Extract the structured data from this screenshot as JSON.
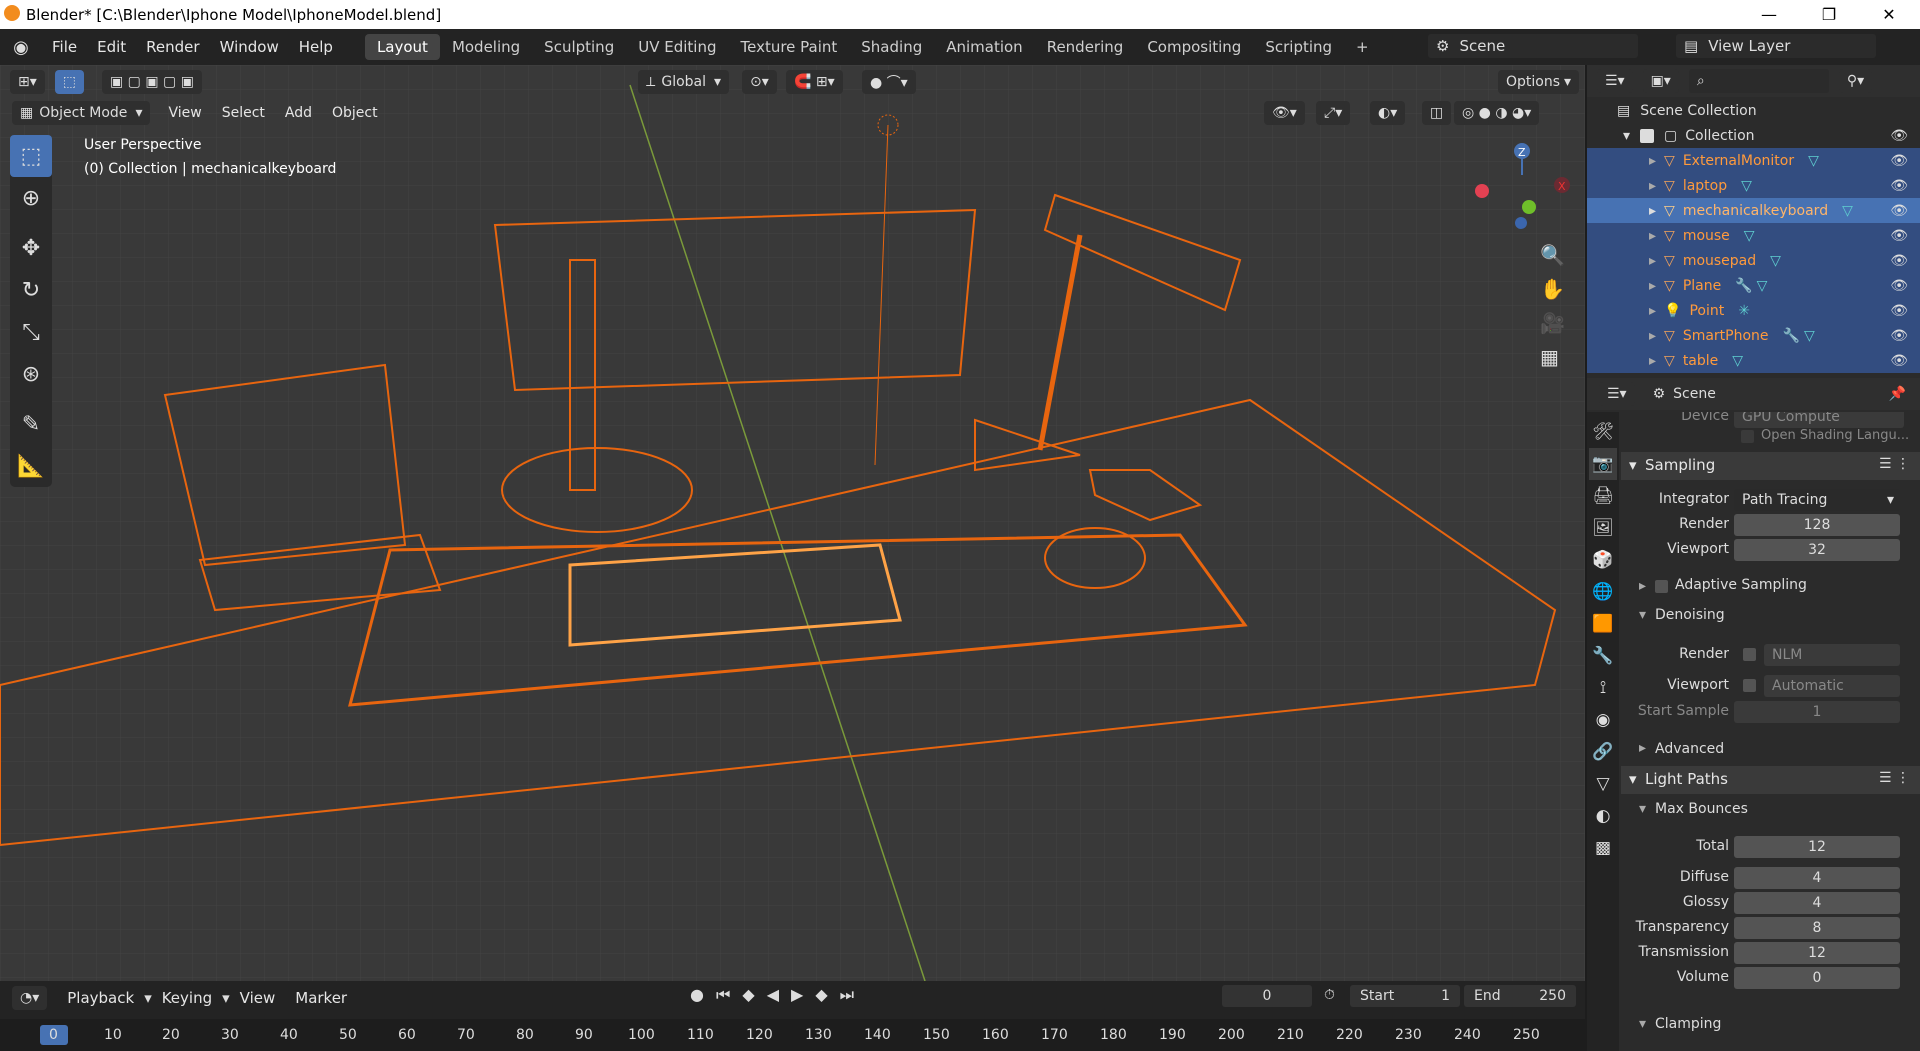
{
  "window": {
    "title": "Blender* [C:\\Blender\\Iphone Model\\IphoneModel.blend]",
    "min": "—",
    "max": "❐",
    "close": "✕"
  },
  "menus": [
    "File",
    "Edit",
    "Render",
    "Window",
    "Help"
  ],
  "workspaces": [
    "Layout",
    "Modeling",
    "Sculpting",
    "UV Editing",
    "Texture Paint",
    "Shading",
    "Animation",
    "Rendering",
    "Compositing",
    "Scripting",
    "+"
  ],
  "scene": {
    "name": "Scene",
    "view_layer": "View Layer"
  },
  "viewport": {
    "mode": "Object Mode",
    "menus": [
      "View",
      "Select",
      "Add",
      "Object"
    ],
    "orientation": "Global",
    "options": "Options",
    "perspective": "User Perspective",
    "collection_info": "(0) Collection | mechanicalkeyboard",
    "gizmo": {
      "z": "Z",
      "x": "X"
    }
  },
  "outliner": {
    "root": "Scene Collection",
    "collection": "Collection",
    "items": [
      {
        "name": "ExternalMonitor",
        "selected": true
      },
      {
        "name": "laptop",
        "selected": true
      },
      {
        "name": "mechanicalkeyboard",
        "selected": true,
        "active": true
      },
      {
        "name": "mouse",
        "selected": true
      },
      {
        "name": "mousepad",
        "selected": true
      },
      {
        "name": "Plane",
        "selected": true
      },
      {
        "name": "Point",
        "selected": true
      },
      {
        "name": "SmartPhone",
        "selected": true
      },
      {
        "name": "table",
        "selected": true
      }
    ]
  },
  "properties": {
    "context": "Scene",
    "device_label": "Device",
    "device_value": "GPU Compute",
    "open_shading": "Open Shading Langu...",
    "sampling": {
      "title": "Sampling",
      "integrator_label": "Integrator",
      "integrator": "Path Tracing",
      "render_label": "Render",
      "render": "128",
      "viewport_label": "Viewport",
      "viewport": "32",
      "adaptive": "Adaptive Sampling",
      "denoising": "Denoising",
      "den_render_label": "Render",
      "den_render": "NLM",
      "den_viewport_label": "Viewport",
      "den_viewport": "Automatic",
      "start_sample_label": "Start Sample",
      "start_sample": "1",
      "advanced": "Advanced"
    },
    "light_paths": {
      "title": "Light Paths",
      "max_bounces": "Max Bounces",
      "rows": [
        {
          "label": "Total",
          "value": "12"
        },
        {
          "label": "Diffuse",
          "value": "4"
        },
        {
          "label": "Glossy",
          "value": "4"
        },
        {
          "label": "Transparency",
          "value": "8"
        },
        {
          "label": "Transmission",
          "value": "12"
        },
        {
          "label": "Volume",
          "value": "0"
        }
      ],
      "clamping": "Clamping"
    }
  },
  "timeline": {
    "menus": [
      "Playback",
      "Keying",
      "View",
      "Marker"
    ],
    "current_frame": "0",
    "start_label": "Start",
    "start": "1",
    "end_label": "End",
    "end": "250",
    "ruler": [
      "0",
      "10",
      "20",
      "30",
      "40",
      "50",
      "60",
      "70",
      "80",
      "90",
      "100",
      "110",
      "120",
      "130",
      "140",
      "150",
      "160",
      "170",
      "180",
      "190",
      "200",
      "210",
      "220",
      "230",
      "240",
      "250"
    ]
  },
  "colors": {
    "selection": "#e8650f",
    "active": "#ffa347",
    "accent": "#4772b3"
  }
}
